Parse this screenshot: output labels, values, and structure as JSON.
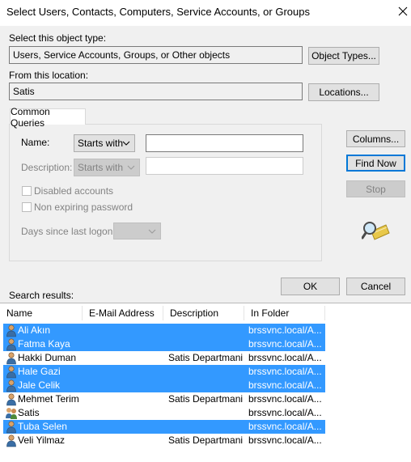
{
  "window": {
    "title": "Select Users, Contacts, Computers, Service Accounts, or Groups"
  },
  "object_type": {
    "label": "Select this object type:",
    "value": "Users, Service Accounts, Groups, or Other objects",
    "button": "Object Types..."
  },
  "location": {
    "label": "From this location:",
    "value": "Satis",
    "button": "Locations..."
  },
  "queries": {
    "tab": "Common Queries",
    "name_label": "Name:",
    "name_mode": "Starts with",
    "name_value": "",
    "description_label": "Description:",
    "description_mode": "Starts with",
    "description_value": "",
    "disabled_accounts": "Disabled accounts",
    "non_expiring": "Non expiring password",
    "days_label": "Days since last logon:",
    "days_value": ""
  },
  "side_buttons": {
    "columns": "Columns...",
    "find_now": "Find Now",
    "stop": "Stop"
  },
  "actions": {
    "ok": "OK",
    "cancel": "Cancel"
  },
  "results": {
    "label": "Search results:",
    "columns": [
      "Name",
      "E-Mail Address",
      "Description",
      "In Folder"
    ],
    "rows": [
      {
        "name": "Ali Akın",
        "email": "",
        "description": "",
        "folder": "brssvnc.local/A...",
        "selected": true,
        "icon": "user-icon"
      },
      {
        "name": "Fatma Kaya",
        "email": "",
        "description": "",
        "folder": "brssvnc.local/A...",
        "selected": true,
        "icon": "user-icon"
      },
      {
        "name": "Hakki Duman",
        "email": "",
        "description": "Satis Departmani",
        "folder": "brssvnc.local/A...",
        "selected": false,
        "icon": "user-icon"
      },
      {
        "name": "Hale Gazi",
        "email": "",
        "description": "",
        "folder": "brssvnc.local/A...",
        "selected": true,
        "icon": "user-icon"
      },
      {
        "name": "Jale Celik",
        "email": "",
        "description": "",
        "folder": "brssvnc.local/A...",
        "selected": true,
        "icon": "user-icon"
      },
      {
        "name": "Mehmet Terim",
        "email": "",
        "description": "Satis Departmani",
        "folder": "brssvnc.local/A...",
        "selected": false,
        "icon": "user-icon"
      },
      {
        "name": "Satis",
        "email": "",
        "description": "",
        "folder": "brssvnc.local/A...",
        "selected": false,
        "icon": "group-icon"
      },
      {
        "name": "Tuba Selen",
        "email": "",
        "description": "",
        "folder": "brssvnc.local/A...",
        "selected": true,
        "icon": "user-icon"
      },
      {
        "name": "Veli Yilmaz",
        "email": "",
        "description": "Satis Departmani",
        "folder": "brssvnc.local/A...",
        "selected": false,
        "icon": "user-icon"
      }
    ]
  },
  "colors": {
    "selection": "#3399ff",
    "dialog_bg": "#f0f0f0",
    "focus_border": "#0078d7"
  }
}
